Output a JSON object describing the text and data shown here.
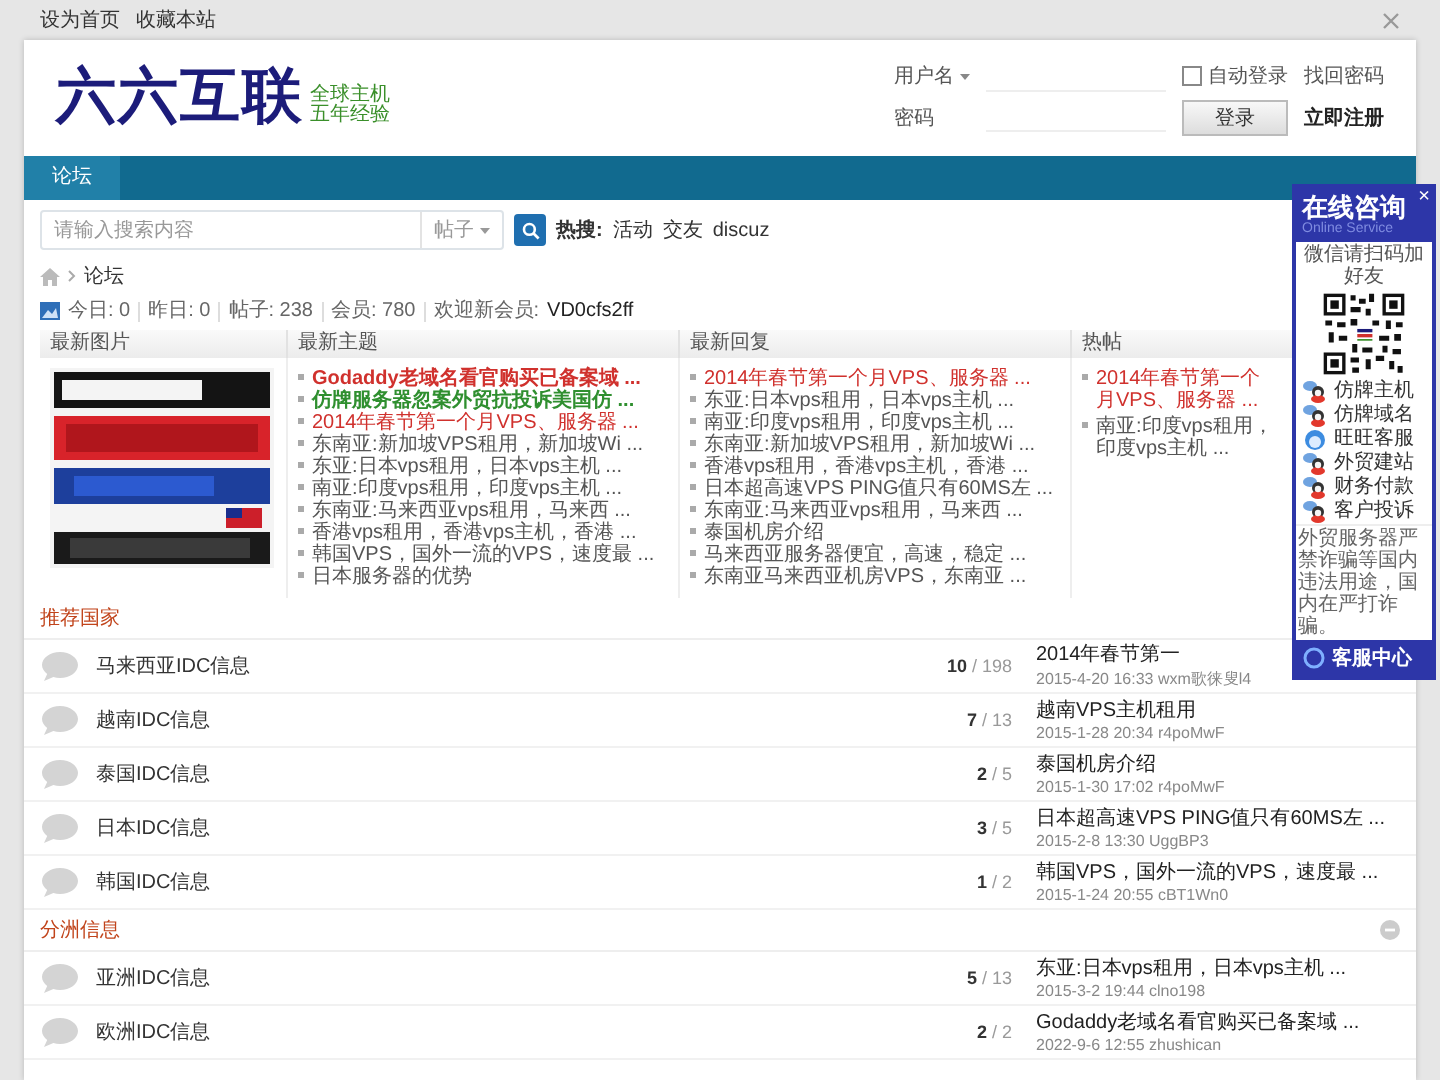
{
  "top_links": [
    "设为首页",
    "收藏本站"
  ],
  "logo": {
    "name": "六六互联",
    "tagline": [
      "全球主机",
      "五年经验"
    ]
  },
  "login": {
    "username_label": "用户名",
    "auto_login": {
      "label": "自动登录",
      "checked": false
    },
    "forgot": "找回密码",
    "password_label": "密码",
    "login_button": "登录",
    "register": "立即注册"
  },
  "nav": [
    {
      "label": "论坛",
      "selected": true
    }
  ],
  "search": {
    "placeholder": "请输入搜索内容",
    "scope": "帖子",
    "hot_label": "热搜:",
    "hot": [
      "活动",
      "交友",
      "discuz"
    ]
  },
  "breadcrumb": [
    "论坛"
  ],
  "stats": [
    "今日: 0",
    "昨日: 0",
    "帖子: 238",
    "会员: 780"
  ],
  "newest_member": {
    "label": "欢迎新会员:",
    "name": "VD0cfs2ff"
  },
  "latest": {
    "columns": [
      "最新图片",
      "最新主题",
      "最新回复",
      "热帖"
    ],
    "picture": {
      "kind": "picture"
    },
    "topics": [
      {
        "title": "Godaddy老域名看官购买已备案域 ...",
        "color": "#d0312d",
        "bold": true
      },
      {
        "title": "仿牌服务器忽案外贸抗投诉美国仿 ...",
        "color": "#2f8f2f",
        "bold": true
      },
      {
        "title": "2014年春节第一个月VPS、服务器 ...",
        "color": "#d0312d"
      },
      {
        "title": "东南亚:新加坡VPS租用，新加坡Wi ..."
      },
      {
        "title": "东亚:日本vps租用，日本vps主机 ..."
      },
      {
        "title": "南亚:印度vps租用，印度vps主机 ..."
      },
      {
        "title": "东南亚:马来西亚vps租用，马来西 ..."
      },
      {
        "title": "香港vps租用，香港vps主机，香港 ..."
      },
      {
        "title": "韩国VPS，国外一流的VPS，速度最 ..."
      },
      {
        "title": "日本服务器的优势"
      }
    ],
    "replies": [
      {
        "title": "2014年春节第一个月VPS、服务器 ...",
        "color": "#d0312d"
      },
      {
        "title": "东亚:日本vps租用，日本vps主机 ..."
      },
      {
        "title": "南亚:印度vps租用，印度vps主机 ..."
      },
      {
        "title": "东南亚:新加坡VPS租用，新加坡Wi ..."
      },
      {
        "title": "香港vps租用，香港vps主机，香港 ..."
      },
      {
        "title": "日本超高速VPS PING值只有60MS左 ..."
      },
      {
        "title": "东南亚:马来西亚vps租用，马来西 ..."
      },
      {
        "title": "泰国机房介绍"
      },
      {
        "title": "马来西亚服务器便宜，高速，稳定 ..."
      },
      {
        "title": "东南亚马来西亚机房VPS，东南亚 ..."
      }
    ],
    "hot": [
      {
        "title": "2014年春节第一个月VPS、服务器 ...",
        "color": "#d0312d"
      },
      {
        "title": "南亚:印度vps租用，印度vps主机 ..."
      }
    ]
  },
  "sections": [
    {
      "title": "推荐国家",
      "forums": [
        {
          "name": "马来西亚IDC信息",
          "today": "10",
          "total": "/ 198",
          "last_title": "2014年春节第一",
          "last_meta": "2015-4-20 16:33 wxm歌徕叟l4"
        },
        {
          "name": "越南IDC信息",
          "today": "7",
          "total": "/ 13",
          "last_title": "越南VPS主机租用",
          "last_meta": "2015-1-28 20:34 r4poMwF"
        },
        {
          "name": "泰国IDC信息",
          "today": "2",
          "total": "/ 5",
          "last_title": "泰国机房介绍",
          "last_meta": "2015-1-30 17:02 r4poMwF"
        },
        {
          "name": "日本IDC信息",
          "today": "3",
          "total": "/ 5",
          "last_title": "日本超高速VPS PING值只有60MS左 ...",
          "last_meta": "2015-2-8 13:30 UggBP3"
        },
        {
          "name": "韩国IDC信息",
          "today": "1",
          "total": "/ 2",
          "last_title": "韩国VPS，国外一流的VPS，速度最 ...",
          "last_meta": "2015-1-24 20:55 cBT1Wn0"
        }
      ]
    },
    {
      "title": "分洲信息",
      "collapsed": false,
      "forums": [
        {
          "name": "亚洲IDC信息",
          "today": "5",
          "total": "/ 13",
          "last_title": "东亚:日本vps租用，日本vps主机 ...",
          "last_meta": "2015-3-2 19:44 clno198"
        },
        {
          "name": "欧洲IDC信息",
          "today": "2",
          "total": "/ 2",
          "last_title": "Godaddy老域名看官购买已备案域 ...",
          "last_meta": "2022-9-6 12:55 zhushican"
        }
      ]
    }
  ],
  "service_panel": {
    "title": "在线咨询",
    "subtitle": "Online Service",
    "close": "×",
    "wechat_hint": "微信请扫码加好友",
    "items": [
      {
        "label": "仿牌主机",
        "kind": "qq"
      },
      {
        "label": "仿牌域名",
        "kind": "qq"
      },
      {
        "label": "旺旺客服",
        "kind": "ww"
      },
      {
        "label": "外贸建站",
        "kind": "qq"
      },
      {
        "label": "财务付款",
        "kind": "qq"
      },
      {
        "label": "客户投诉",
        "kind": "qq"
      }
    ],
    "notice": "外贸服务器严禁诈骗等国内违法用途，国内在严打诈骗。",
    "footer": "客服中心"
  }
}
